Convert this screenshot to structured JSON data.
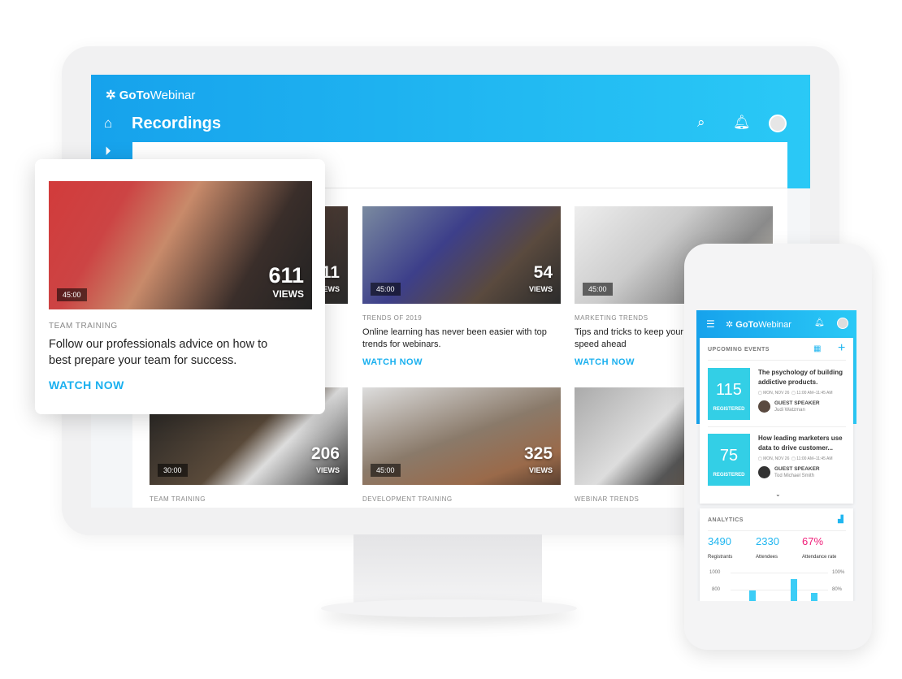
{
  "desktop": {
    "brand_bold": "GoTo",
    "brand_light": "Webinar",
    "page_title": "Recordings",
    "icons": [
      "home-icon",
      "play-icon",
      "search-icon",
      "bell-icon",
      "avatar"
    ],
    "cards": [
      {
        "views": "611",
        "views_label": "VIEWS",
        "duration": "",
        "category": "",
        "title": "",
        "watch": ""
      },
      {
        "views": "54",
        "views_label": "VIEWS",
        "duration": "45:00",
        "category": "TRENDS OF 2019",
        "title": "Online learning has never been easier with top trends for webinars.",
        "watch": "WATCH NOW"
      },
      {
        "views": "",
        "views_label": "",
        "duration": "45:00",
        "category": "MARKETING TRENDS",
        "title": "Tips and tricks to keep your plan moving full speed ahead",
        "watch": "WATCH NOW"
      },
      {
        "views": "206",
        "views_label": "VIEWS",
        "duration": "30:00",
        "category": "TEAM TRAINING",
        "title": "",
        "watch": ""
      },
      {
        "views": "325",
        "views_label": "VIEWS",
        "duration": "45:00",
        "category": "DEVELOPMENT TRAINING",
        "title": "",
        "watch": ""
      },
      {
        "views": "",
        "views_label": "",
        "duration": "",
        "category": "WEBINAR TRENDS",
        "title": "",
        "watch": ""
      }
    ]
  },
  "featured": {
    "views": "611",
    "views_label": "VIEWS",
    "duration": "45:00",
    "category": "TEAM TRAINING",
    "title": "Follow our professionals advice on how to best prepare your team for success.",
    "watch": "WATCH NOW"
  },
  "mobile": {
    "brand_bold": "GoTo",
    "brand_light": "Webinar",
    "upcoming_title": "UPCOMING EVENTS",
    "events": [
      {
        "count": "115",
        "label": "REGISTERED",
        "title": "The psychology of building addictive products.",
        "date": "MON, NOV 26",
        "time": "11:00 AM–11:45 AM",
        "speaker_role": "GUEST SPEAKER",
        "speaker": "Judi Watzman"
      },
      {
        "count": "75",
        "label": "REGISTERED",
        "title": "How leading marketers use data to drive customer...",
        "date": "MON, NOV 26",
        "time": "11:00 AM–11:45 AM",
        "speaker_role": "GUEST SPEAKER",
        "speaker": "Tod Michael Smith"
      }
    ],
    "analytics_title": "ANALYTICS",
    "stats": [
      {
        "value": "3490",
        "label": "Registrants",
        "color": "#20b6f0"
      },
      {
        "value": "2330",
        "label": "Attendees",
        "color": "#20b6f0"
      },
      {
        "value": "67%",
        "label": "Attendance rate",
        "color": "#f0207a"
      }
    ],
    "axis_left": [
      "1000",
      "800"
    ],
    "axis_right": [
      "100%",
      "80%"
    ]
  }
}
